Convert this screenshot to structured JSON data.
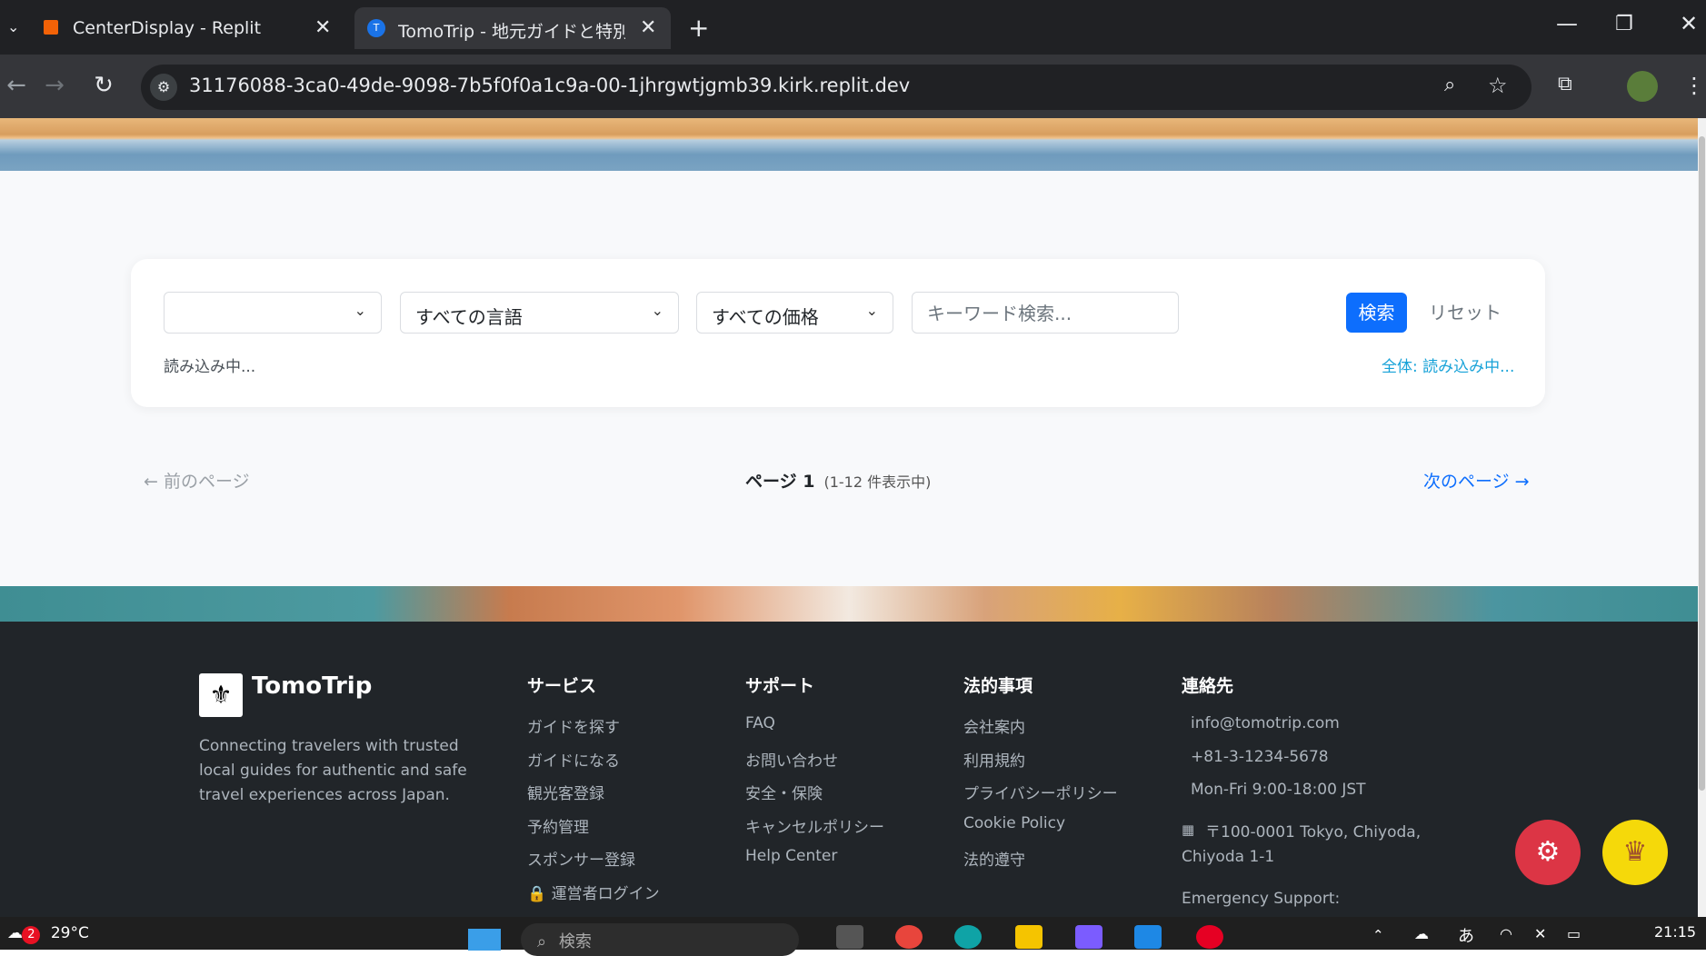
{
  "browser": {
    "tabs": [
      {
        "title": "CenterDisplay - Replit",
        "active": false
      },
      {
        "title": "TomoTrip - 地元ガイドと特別な旅",
        "active": true
      }
    ],
    "url": "31176088-3ca0-49de-9098-7b5f0f0a1c9a-00-1jhrgwtjgmb39.kirk.replit.dev"
  },
  "filters": {
    "region_select": "",
    "language_select": "すべての言語",
    "price_select": "すべての価格",
    "keyword_placeholder": "キーワード検索...",
    "search_label": "検索",
    "reset_label": "リセット",
    "loading_text": "読み込み中...",
    "total_text": "全体: 読み込み中..."
  },
  "pagination": {
    "prev_label": "← 前のページ",
    "page_label": "ページ 1",
    "range_label": "(1-12 件表示中)",
    "next_label": "次のページ →"
  },
  "footer": {
    "brand": "TomoTrip",
    "tagline": "Connecting travelers with trusted local guides for authentic and safe travel experiences across Japan.",
    "columns": [
      {
        "heading": "サービス",
        "links": [
          "ガイドを探す",
          "ガイドになる",
          "観光客登録",
          "予約管理",
          "スポンサー登録",
          "🔒 運営者ログイン"
        ]
      },
      {
        "heading": "サポート",
        "links": [
          "FAQ",
          "お問い合わせ",
          "安全・保険",
          "キャンセルポリシー",
          "Help Center"
        ]
      },
      {
        "heading": "法的事項",
        "links": [
          "会社案内",
          "利用規約",
          "プライバシーポリシー",
          "Cookie Policy",
          "法的遵守"
        ]
      },
      {
        "heading": "連絡先",
        "links": [
          "info@tomotrip.com",
          "+81-3-1234-5678",
          "Mon-Fri 9:00-18:00 JST",
          "〒100-0001 Tokyo, Chiyoda, Chiyoda 1-1",
          "Emergency Support:"
        ]
      }
    ]
  },
  "taskbar": {
    "weather": "29°C",
    "badge": "2",
    "search_placeholder": "検索",
    "time": "21:15"
  },
  "colors": {
    "primary": "#0d6efd",
    "footer_bg": "#212529",
    "fab_red": "#dc3545",
    "fab_yellow": "#f5d90a"
  }
}
